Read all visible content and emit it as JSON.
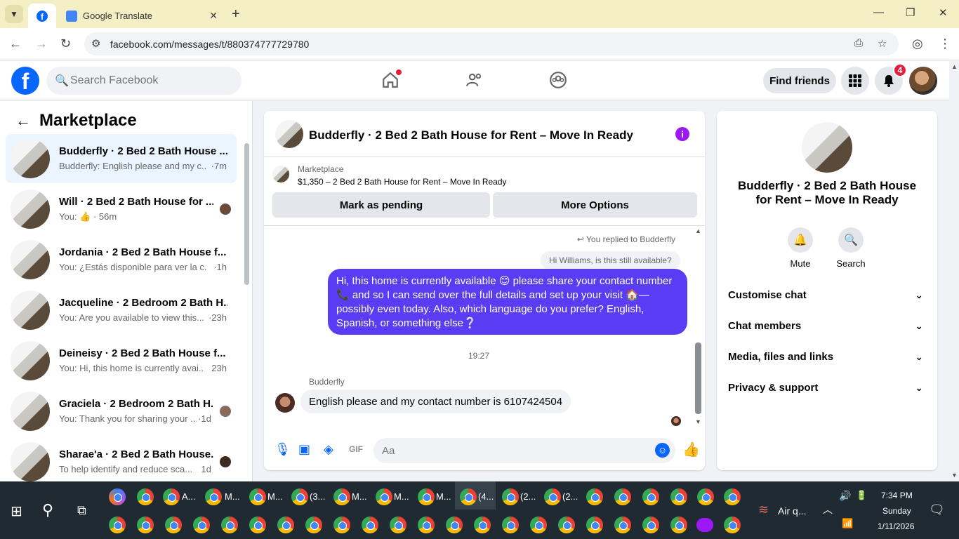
{
  "browser": {
    "tabs": [
      {
        "label": "",
        "icon": "facebook-icon"
      },
      {
        "label": "Google Translate",
        "icon": "google-translate-icon"
      }
    ],
    "url": "facebook.com/messages/t/880374777729780"
  },
  "header": {
    "search_placeholder": "Search Facebook",
    "find_friends": "Find friends",
    "notification_count": "4"
  },
  "sidebar": {
    "title": "Marketplace",
    "conversations": [
      {
        "name": "Budderfly · 2 Bed 2 Bath House ...",
        "snippet": "Budderfly: English please and my c...",
        "time": "·7m",
        "selected": true
      },
      {
        "name": "Will · 2 Bed 2 Bath House for ...",
        "snippet": "You: 👍 · 56m",
        "time": ""
      },
      {
        "name": "Jordania · 2 Bed 2 Bath House f...",
        "snippet": "You: ¿Estás disponible para ver la c...",
        "time": "·1h"
      },
      {
        "name": "Jacqueline · 2 Bedroom 2 Bath H...",
        "snippet": "You: Are you available to view this...",
        "time": "·23h"
      },
      {
        "name": "Deineisy · 2 Bed 2 Bath House f...",
        "snippet": "You: Hi, this home is currently avai...",
        "time": "23h"
      },
      {
        "name": "Graciela · 2 Bedroom 2 Bath H...",
        "snippet": "You: Thank you for sharing your ...",
        "time": "·1d"
      },
      {
        "name": "Sharae'a · 2 Bed 2 Bath House...",
        "snippet": "To help identify and reduce sca...",
        "time": "1d"
      }
    ]
  },
  "chat": {
    "title": "Budderfly · 2 Bed 2 Bath House for Rent – Move In Ready",
    "marketplace_label": "Marketplace",
    "listing": "$1,350 – 2 Bed 2 Bath House for Rent – Move In Ready",
    "mark_pending": "Mark as pending",
    "more_options": "More Options",
    "replied_to": "You replied to Budderfly",
    "quoted": "Hi Williams, is this still available?",
    "my_message": "Hi, this home is currently available 😊 please share your contact number 📞 and  so I can send over the full details and set up your visit 🏠—possibly even today. Also, which language do you prefer? English, Spanish, or something else❔",
    "timestamp": "19:27",
    "sender": "Budderfly",
    "their_message": "English please and my contact number is 6107424504",
    "composer_placeholder": "Aa"
  },
  "info": {
    "title": "Budderfly · 2 Bed 2 Bath House for Rent – Move In Ready",
    "mute": "Mute",
    "search": "Search",
    "sections": [
      "Customise chat",
      "Chat members",
      "Media, files and links",
      "Privacy & support"
    ]
  },
  "taskbar": {
    "labels_row1": [
      "A...",
      "M...",
      "M...",
      "(3...",
      "M...",
      "M...",
      "M...",
      "(4...",
      "(2...",
      "(2..."
    ],
    "weather": "Air q...",
    "time": "7:34 PM",
    "day": "Sunday",
    "date": "1/11/2026"
  }
}
